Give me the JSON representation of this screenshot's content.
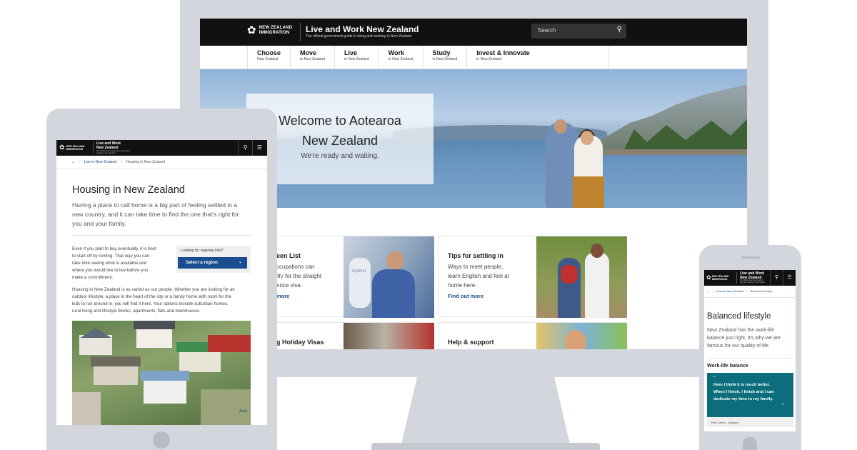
{
  "brand": {
    "logo_line1": "NEW ZEALAND",
    "logo_line2": "IMMIGRATION",
    "site_title": "Live and Work New Zealand",
    "site_subtitle": "The official government guide to living and working in New Zealand",
    "tablet_title_line1": "Live and Work",
    "tablet_title_line2": "New Zealand",
    "tablet_subtitle": "The official government guide to living and working in New Zealand"
  },
  "desktop": {
    "search_placeholder": "Search",
    "nav": [
      {
        "label": "Choose",
        "sub": "New Zealand"
      },
      {
        "label": "Move",
        "sub": "to New Zealand"
      },
      {
        "label": "Live",
        "sub": "in New Zealand"
      },
      {
        "label": "Work",
        "sub": "in New Zealand"
      },
      {
        "label": "Study",
        "sub": "in New Zealand"
      },
      {
        "label": "Invest & Innovate",
        "sub": "in New Zealand"
      }
    ],
    "hero": {
      "title_line1": "Welcome to Aotearoa",
      "title_line2": "New Zealand",
      "subtitle": "We're ready and waiting."
    },
    "cards": [
      {
        "title": "een List",
        "text_lines": [
          "ccupations can",
          "lify for the straight",
          "ence visa."
        ],
        "link": "more"
      },
      {
        "title": "Tips for settling in",
        "text_lines": [
          "Ways to meet people,",
          "learn English and feel at",
          "home here."
        ],
        "link": "Find out more"
      },
      {
        "title": "g Holiday Visas"
      },
      {
        "title": "Help & support"
      }
    ],
    "machine_label": "Optimo"
  },
  "tablet": {
    "breadcrumb": [
      "Live in New Zealand",
      "Housing in New Zealand"
    ],
    "title": "Housing in New Zealand",
    "lead_lines": [
      "Having a place to call home is a big part of feeling settled in a",
      "new country, and it can take time to find the one that's right for",
      "you and your family."
    ],
    "para1_lines": [
      "Even if you plan to buy eventually, it is best",
      "to start off by renting. That way you can",
      "take time seeing what is available and",
      "where you would like to live before you",
      "make a commitment."
    ],
    "para2_lines": [
      "Housing in New Zealand is as varied as our people. Whether you are looking for an",
      "outdoor lifestyle, a place in the heart of the city or a family home with room for the",
      "kids to run around in, you will find it here. Your options include suburban homes,",
      "rural living and lifestyle blocks, apartments, flats and townhouses."
    ],
    "regional_label": "Looking for regional info?",
    "select_label": "Select a region",
    "image_corner": "Auck"
  },
  "phone": {
    "title_line1": "Live and Work",
    "title_line2": "New Zealand",
    "subtitle": "The official government guide to living and working in New Zealand",
    "breadcrumb": [
      "Choose New Zealand",
      "Balanced lifestyle"
    ],
    "title": "Balanced lifestyle",
    "lead_lines": [
      "New Zealand has the work-life",
      "balance just right. It's why we are",
      "famous for our quality of life."
    ],
    "section": "Work-life balance",
    "quote_lines": [
      "Here I think it is much better.",
      "When I finish, I finish and I can",
      "dedicate my time to my family."
    ],
    "caption": "Rita Caeko - Amigery"
  },
  "colors": {
    "header": "#111111",
    "link": "#1a4d8f",
    "teal": "#0c6e7c",
    "device": "#d3d6dc"
  }
}
